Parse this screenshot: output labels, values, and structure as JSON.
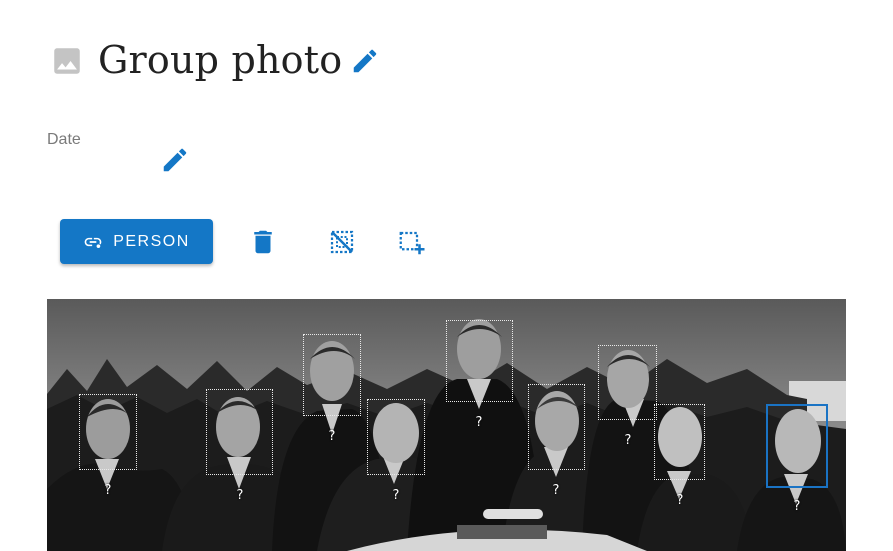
{
  "header": {
    "title": "Group photo",
    "title_icon": "image-icon",
    "edit_icon": "pencil-icon"
  },
  "date": {
    "label": "Date",
    "value": "",
    "edit_icon": "pencil-icon"
  },
  "toolbar": {
    "person_label": "PERSON",
    "person_icon": "link-person-icon",
    "delete_icon": "trash-icon",
    "remove_region_icon": "region-off-icon",
    "add_region_icon": "region-add-icon"
  },
  "photo": {
    "faces": [
      {
        "label": "?",
        "selected": false
      },
      {
        "label": "?",
        "selected": false
      },
      {
        "label": "?",
        "selected": false
      },
      {
        "label": "?",
        "selected": false
      },
      {
        "label": "?",
        "selected": false
      },
      {
        "label": "?",
        "selected": false
      },
      {
        "label": "?",
        "selected": false
      },
      {
        "label": "?",
        "selected": false
      },
      {
        "label": "?",
        "selected": false
      },
      {
        "label": "?",
        "selected": true
      }
    ]
  },
  "colors": {
    "accent": "#1477c6",
    "selected_border": "#1a73c4",
    "icon_gray": "#bdbdbd"
  }
}
